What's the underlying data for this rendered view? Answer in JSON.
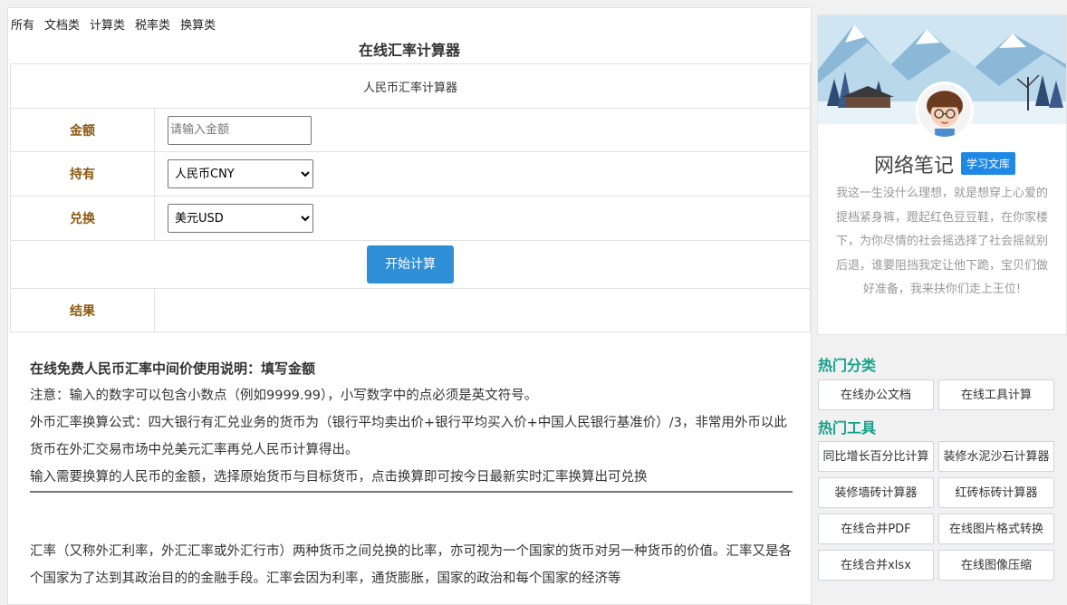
{
  "nav": [
    "所有",
    "文档类",
    "计算类",
    "税率类",
    "换算类"
  ],
  "page_title": "在线汇率计算器",
  "calculator": {
    "header": "人民币汇率计算器",
    "amount_label": "金额",
    "amount_placeholder": "请输入金额",
    "hold_label": "持有",
    "hold_value": "人民币CNY",
    "exchange_label": "兑换",
    "exchange_value": "美元USD",
    "start_button": "开始计算",
    "result_label": "结果"
  },
  "description": {
    "heading": "在线免费人民币汇率中间价使用说明：填写金额",
    "note": "注意：输入的数字可以包含小数点（例如9999.99），小写数字中的点必须是英文符号。",
    "formula": "外币汇率换算公式：四大银行有汇兑业务的货币为（银行平均卖出价+银行平均买入价+中国人民银行基准价）/3，非常用外币以此货币在外汇交易市场中兑美元汇率再兑人民币计算得出。",
    "instruction": "输入需要换算的人民币的金额，选择原始货币与目标货币，点击换算即可按今日最新实时汇率换算出可兑换",
    "paragraph": "汇率（又称外汇利率，外汇汇率或外汇行市）两种货币之间兑换的比率，亦可视为一个国家的货币对另一种货币的价值。汇率又是各个国家为了达到其政治目的的金融手段。汇率会因为利率，通货膨胀，国家的政治和每个国家的经济等"
  },
  "profile": {
    "name": "网络笔记",
    "badge": "学习文库",
    "bio": "我这一生没什么理想，就是想穿上心爱的提档紧身裤，蹬起红色豆豆鞋，在你家楼下，为你尽情的社会摇选择了社会摇就别后退，谁要阻挡我定让他下跪，宝贝们做好准备，我来扶你们走上王位!"
  },
  "hot_categories": {
    "title": "热门分类",
    "items": [
      "在线办公文档",
      "在线工具计算"
    ]
  },
  "hot_tools": {
    "title": "热门工具",
    "items": [
      "同比增长百分比计算",
      "装修水泥沙石计算器",
      "装修墙砖计算器",
      "红砖标砖计算器",
      "在线合并PDF",
      "在线图片格式转换",
      "在线合并xlsx",
      "在线图像压缩"
    ]
  }
}
